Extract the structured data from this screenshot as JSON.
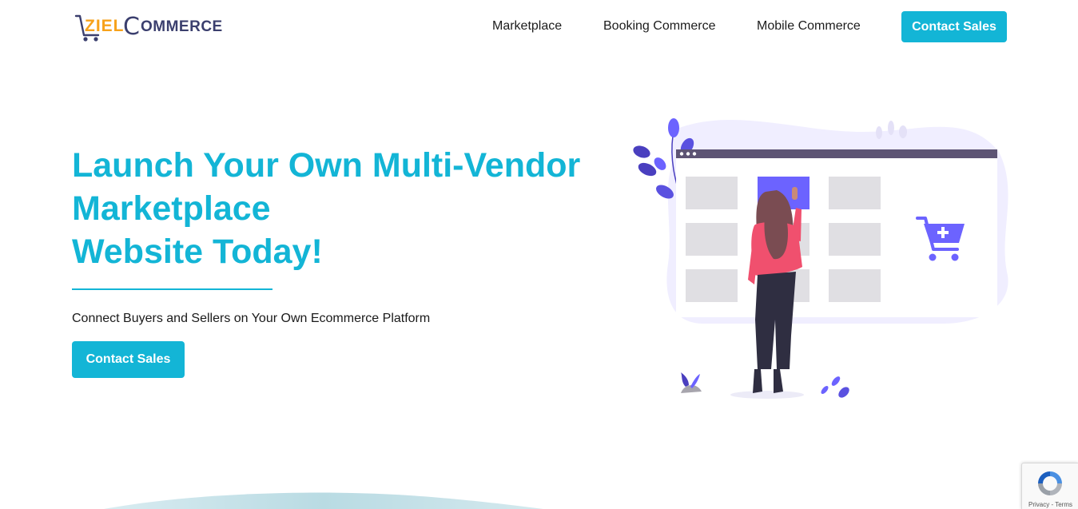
{
  "brand": {
    "logo_ziel": "ZIEL",
    "logo_c": "C",
    "logo_rest": "OMMERCE"
  },
  "nav": {
    "items": [
      {
        "label": "Marketplace"
      },
      {
        "label": "Booking Commerce"
      },
      {
        "label": "Mobile Commerce"
      }
    ],
    "cta_label": "Contact Sales"
  },
  "hero": {
    "title_lines": [
      "Launch Your Own Multi-Vendor",
      "Marketplace",
      "Website Today!"
    ],
    "subtitle": "Connect Buyers and Sellers on Your Own Ecommerce Platform",
    "cta_label": "Contact Sales"
  },
  "recaptcha": {
    "text": "Privacy - Terms"
  },
  "colors": {
    "accent": "#13b5d6",
    "logo_orange": "#f7a21b",
    "logo_navy": "#3b3f6e",
    "illustration_purple": "#6c63ff",
    "illustration_pink": "#f0506e"
  },
  "icons": [
    "shopping-cart-icon",
    "add-to-cart-icon",
    "recaptcha-icon"
  ]
}
